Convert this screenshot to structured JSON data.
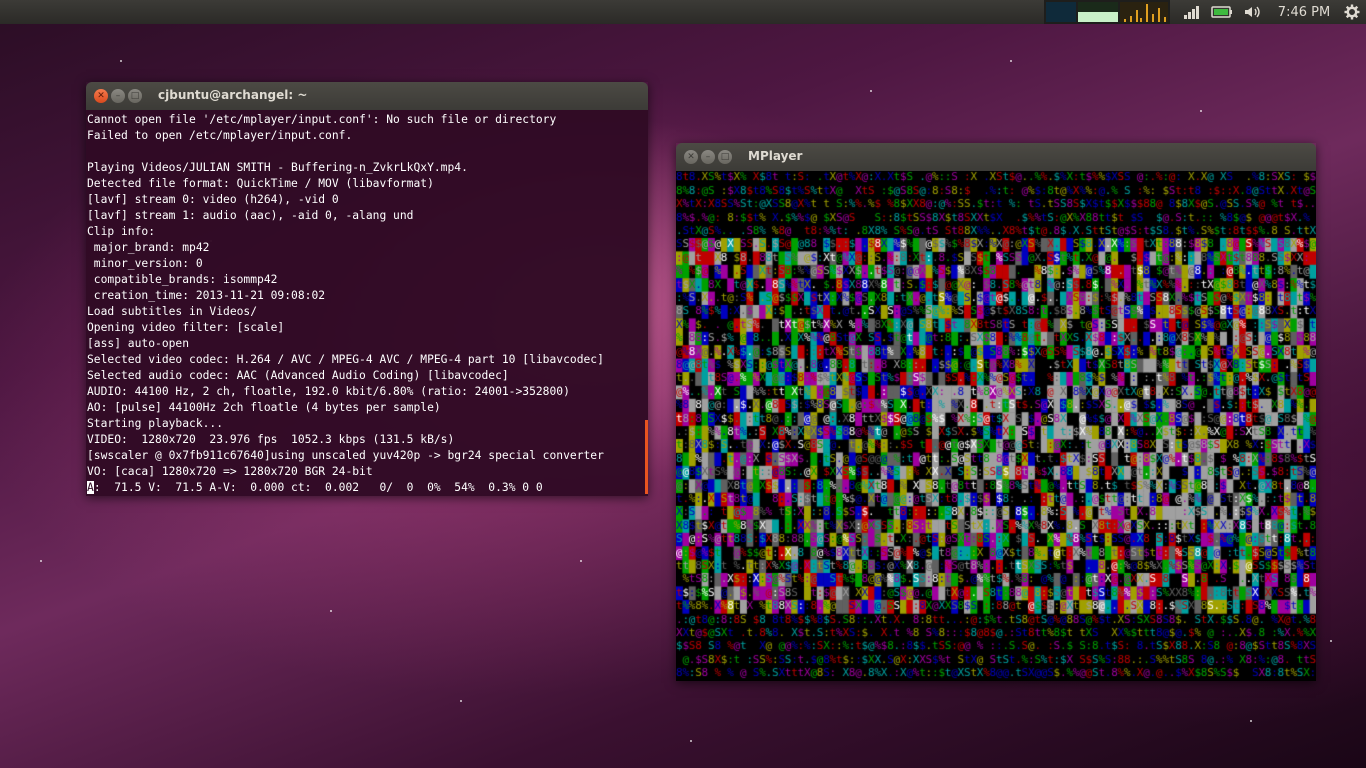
{
  "top_panel": {
    "clock": "7:46 PM"
  },
  "terminal": {
    "title": "cjbuntu@archangel: ~",
    "lines": [
      "Cannot open file '/etc/mplayer/input.conf': No such file or directory",
      "Failed to open /etc/mplayer/input.conf.",
      "",
      "Playing Videos/JULIAN SMITH - Buffering-n_ZvkrLkQxY.mp4.",
      "Detected file format: QuickTime / MOV (libavformat)",
      "[lavf] stream 0: video (h264), -vid 0",
      "[lavf] stream 1: audio (aac), -aid 0, -alang und",
      "Clip info:",
      " major_brand: mp42",
      " minor_version: 0",
      " compatible_brands: isommp42",
      " creation_time: 2013-11-21 09:08:02",
      "Load subtitles in Videos/",
      "Opening video filter: [scale]",
      "[ass] auto-open",
      "Selected video codec: H.264 / AVC / MPEG-4 AVC / MPEG-4 part 10 [libavcodec]",
      "Selected audio codec: AAC (Advanced Audio Coding) [libavcodec]",
      "AUDIO: 44100 Hz, 2 ch, floatle, 192.0 kbit/6.80% (ratio: 24001->352800)",
      "AO: [pulse] 44100Hz 2ch floatle (4 bytes per sample)",
      "Starting playback...",
      "VIDEO:  1280x720  23.976 fps  1052.3 kbps (131.5 kB/s)",
      "[swscaler @ 0x7fb911c67640]using unscaled yuv420p -> bgr24 special converter",
      "VO: [caca] 1280x720 => 1280x720 BGR 24-bit"
    ],
    "cursor_char": "A",
    "status_line": ":  71.5 V:  71.5 A-V:  0.000 ct:  0.002   0/  0  0%  54%  0.3% 0 0"
  },
  "mplayer": {
    "title": "MPlayer",
    "ascii_chars": "%$t:X8@S. ",
    "palette": [
      "#c00000",
      "#00a000",
      "#0000c0",
      "#a0a000",
      "#a000a0",
      "#00a0a0",
      "#a0a0a0",
      "#606060",
      "#ffffff",
      "#e0a000",
      "#000000"
    ]
  },
  "icons": {
    "network": "signal-bars-icon",
    "battery": "battery-icon",
    "volume": "speaker-icon",
    "settings": "gear-icon"
  }
}
